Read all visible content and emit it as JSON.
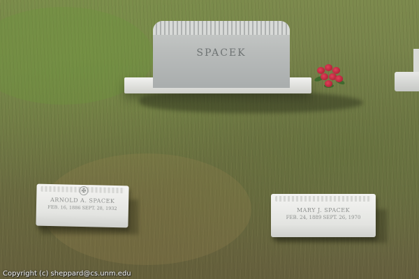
{
  "headstone": {
    "name": "SPACEK"
  },
  "marker_left": {
    "name": "ARNOLD A. SPACEK",
    "dates": "FEB. 16, 1886 SEPT. 28, 1932",
    "emblem": "cross-circle-icon"
  },
  "marker_right": {
    "name": "MARY J. SPACEK",
    "dates": "FEB. 24, 1889 SEPT. 26, 1970"
  },
  "copyright": "Copyright (c) sheppard@cs.unm.edu",
  "colors": {
    "grass": "#75804a",
    "stone": "#bfc2c1",
    "marker": "#eeeeec",
    "flowers": "#c02a3d"
  }
}
